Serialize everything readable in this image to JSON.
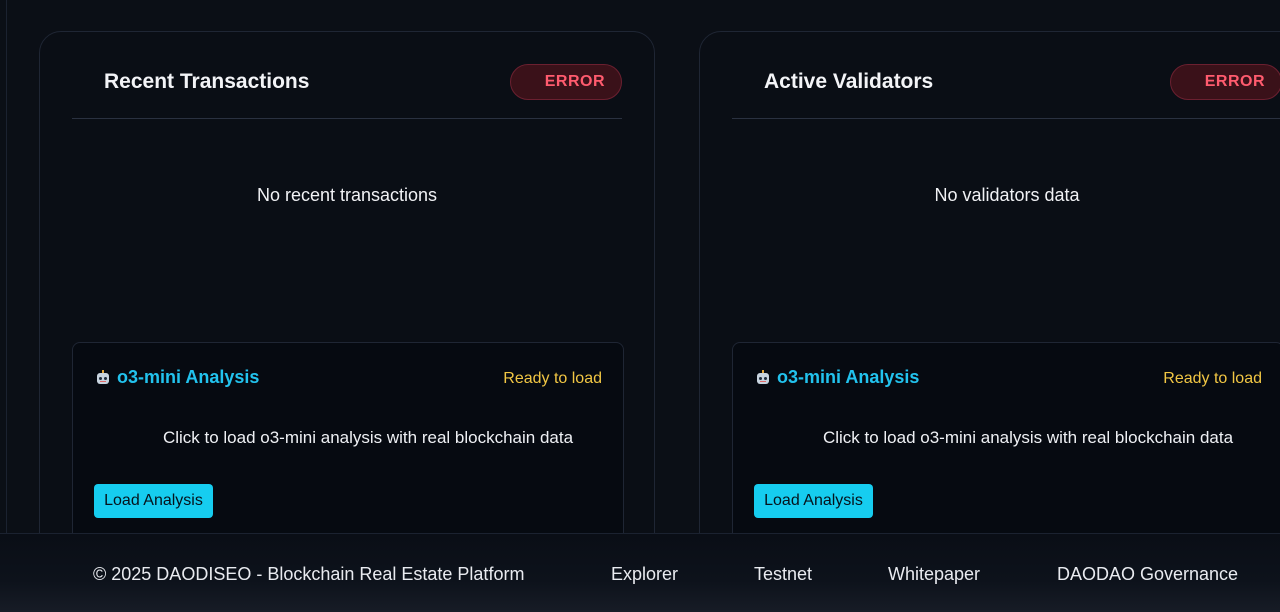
{
  "cards": [
    {
      "title": "Recent Transactions",
      "status_badge": "ERROR",
      "empty_message": "No recent transactions",
      "analysis": {
        "title": "o3-mini Analysis",
        "icon": "robot-icon",
        "status": "Ready to load",
        "description": "Click to load o3-mini analysis with real blockchain data",
        "button_label": "Load Analysis"
      }
    },
    {
      "title": "Active Validators",
      "status_badge": "ERROR",
      "empty_message": "No validators data",
      "analysis": {
        "title": "o3-mini Analysis",
        "icon": "robot-icon",
        "status": "Ready to load",
        "description": "Click to load o3-mini analysis with real blockchain data",
        "button_label": "Load Analysis"
      }
    }
  ],
  "footer": {
    "copyright": "© 2025 DAODISEO - Blockchain Real Estate Platform",
    "links": [
      "Explorer",
      "Testnet",
      "Whitepaper",
      "DAODAO Governance"
    ]
  },
  "colors": {
    "background": "#0b0f16",
    "accent": "#22c3ee",
    "button": "#16cdf0",
    "error": "#ff5b6e",
    "ready": "#f2c744"
  }
}
